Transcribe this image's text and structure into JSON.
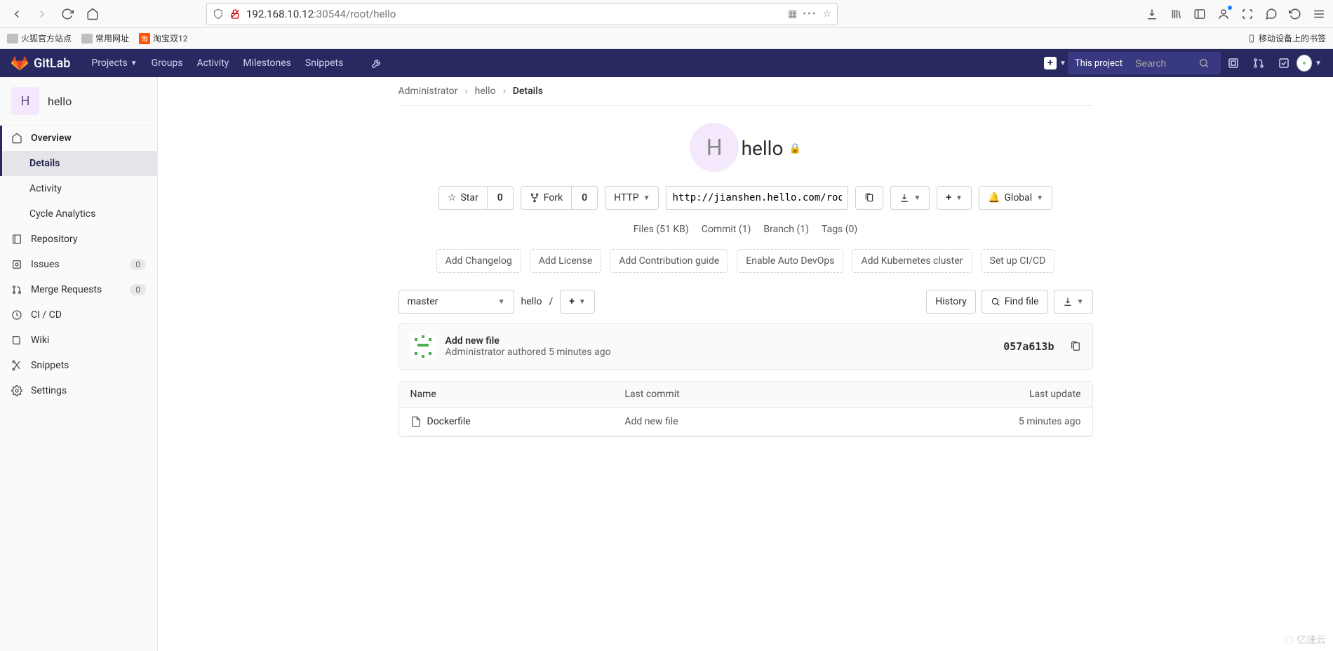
{
  "browser": {
    "url_host": "192.168.10.12",
    "url_port_path": ":30544/root/hello",
    "bookmarks": [
      {
        "label": "火狐官方站点",
        "kind": "folder"
      },
      {
        "label": "常用网址",
        "kind": "folder"
      },
      {
        "label": "淘宝双12",
        "kind": "taobao"
      }
    ],
    "bookmarks_right": "移动设备上的书签"
  },
  "nav": {
    "brand": "GitLab",
    "items": [
      "Projects",
      "Groups",
      "Activity",
      "Milestones",
      "Snippets"
    ],
    "search_scope": "This project",
    "search_placeholder": "Search"
  },
  "sidebar": {
    "project_letter": "H",
    "project_name": "hello",
    "items": [
      {
        "icon": "home",
        "label": "Overview",
        "active": true,
        "sub": [
          {
            "label": "Details",
            "active": true
          },
          {
            "label": "Activity"
          },
          {
            "label": "Cycle Analytics"
          }
        ]
      },
      {
        "icon": "repo",
        "label": "Repository"
      },
      {
        "icon": "issues",
        "label": "Issues",
        "badge": "0"
      },
      {
        "icon": "merge",
        "label": "Merge Requests",
        "badge": "0"
      },
      {
        "icon": "ci",
        "label": "CI / CD"
      },
      {
        "icon": "wiki",
        "label": "Wiki"
      },
      {
        "icon": "snippets",
        "label": "Snippets"
      },
      {
        "icon": "settings",
        "label": "Settings"
      }
    ]
  },
  "breadcrumbs": [
    "Administrator",
    "hello",
    "Details"
  ],
  "project": {
    "letter": "H",
    "name": "hello",
    "star_label": "Star",
    "star_count": "0",
    "fork_label": "Fork",
    "fork_count": "0",
    "clone_proto": "HTTP",
    "clone_url": "http://jianshen.hello.com/root",
    "notify_label": "Global",
    "stats": {
      "files": "Files (51 KB)",
      "commit": "Commit (1)",
      "branch": "Branch (1)",
      "tags": "Tags (0)"
    },
    "suggestions": [
      "Add Changelog",
      "Add License",
      "Add Contribution guide",
      "Enable Auto DevOps",
      "Add Kubernetes cluster",
      "Set up CI/CD"
    ],
    "tree": {
      "branch": "master",
      "path_root": "hello",
      "path_sep": "/",
      "history_btn": "History",
      "find_btn": "Find file"
    },
    "last_commit": {
      "title": "Add new file",
      "author": "Administrator",
      "verb": "authored",
      "when": "5 minutes ago",
      "sha": "057a613b"
    },
    "table": {
      "col_name": "Name",
      "col_commit": "Last commit",
      "col_date": "Last update",
      "rows": [
        {
          "name": "Dockerfile",
          "commit": "Add new file",
          "date": "5 minutes ago"
        }
      ]
    }
  },
  "watermark": "亿速云"
}
